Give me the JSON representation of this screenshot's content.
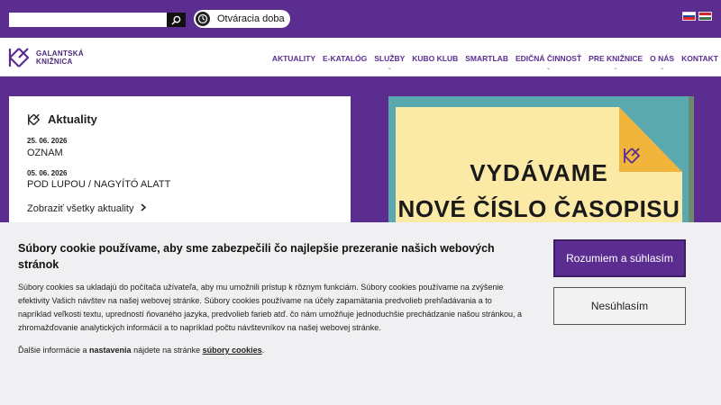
{
  "topbar": {
    "search_placeholder": "",
    "opening_hours_label": "Otváracia doba",
    "languages": [
      "sk",
      "hu"
    ]
  },
  "header": {
    "logo_line1": "GALANTSKÁ",
    "logo_line2": "KNIŽNICA",
    "nav": [
      {
        "label": "AKTUALITY",
        "has_dropdown": false
      },
      {
        "label": "E-KATALÓG",
        "has_dropdown": false
      },
      {
        "label": "SLUŽBY",
        "has_dropdown": true
      },
      {
        "label": "KUBO KLUB",
        "has_dropdown": false
      },
      {
        "label": "SMARTLAB",
        "has_dropdown": false
      },
      {
        "label": "EDIČNÁ ČINNOSŤ",
        "has_dropdown": true
      },
      {
        "label": "PRE KNIŽNICE",
        "has_dropdown": true
      },
      {
        "label": "O NÁS",
        "has_dropdown": true
      },
      {
        "label": "KONTAKT",
        "has_dropdown": false
      }
    ]
  },
  "news": {
    "title": "Aktuality",
    "items": [
      {
        "date": "25. 06. 2026",
        "title": "OZNAM"
      },
      {
        "date": "05. 06. 2026",
        "title": "POD LUPOU / NAGYÍTÓ ALATT"
      }
    ],
    "all_link": "Zobraziť všetky aktuality"
  },
  "banner": {
    "line1": "VYDÁVAME",
    "line2": "NOVÉ ČÍSLO ČASOPISU"
  },
  "cookie": {
    "title": "Súbory cookie používame, aby sme zabezpečili čo najlepšie prezeranie našich webových stránok",
    "body": "Súbory cookies sa ukladajú do počítača užívateľa, aby mu umožnili prístup k rôznym funkciám. Súbory cookies používame na zvýšenie efektivity Vašich návštev na našej webovej stránke. Súbory cookies používame na účely zapamätania predvolieb prehľadávania a to napríklad veľkosti textu, upredností ňovaného jazyka, predvolieb farieb atď. čo nám umožňuje jednoduchšie prechádzanie našou stránkou, a zhromažďovanie analytických informácií a to napríklad počtu návštevníkov na našej webovej stránke.",
    "more_prefix": "Ďalšie informácie a ",
    "more_settings": "nastavenia",
    "more_middle": " nájdete na stránke ",
    "more_link": "súbory cookies",
    "more_suffix": ".",
    "accept_label": "Rozumiem a súhlasím",
    "reject_label": "Nesúhlasím"
  },
  "colors": {
    "brand_purple": "#5b2d91",
    "banner_teal": "#5aa9ae",
    "banner_paper": "#fbe9a6"
  }
}
